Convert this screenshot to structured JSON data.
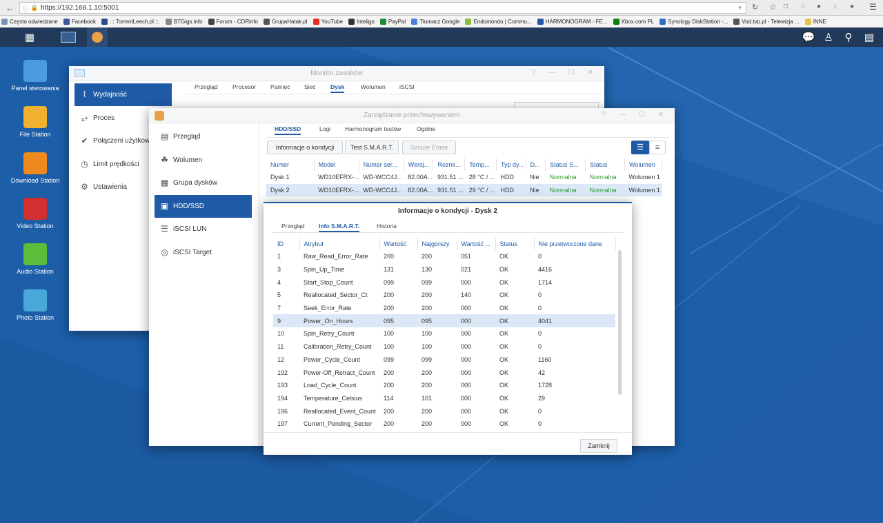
{
  "browser": {
    "url": "https://192.168.1.10:5001",
    "url_highlight": "192.168.1.10",
    "bookmarks": [
      {
        "label": "Często odwiedzane",
        "color": "#7a94b8"
      },
      {
        "label": "Facebook",
        "color": "#3b5998"
      },
      {
        "label": ".:: TorrentLeech.pl ::.",
        "color": "#2c4c8a"
      },
      {
        "label": "BTGigs.info",
        "color": "#888888"
      },
      {
        "label": "Forum - CDRinfo",
        "color": "#444444"
      },
      {
        "label": "GrupaHatak.pl",
        "color": "#555555"
      },
      {
        "label": "YouTube",
        "color": "#e52d27"
      },
      {
        "label": "Inteligo",
        "color": "#333333"
      },
      {
        "label": "PayPal",
        "color": "#1b8e3a"
      },
      {
        "label": "Tłumacz Google",
        "color": "#4a7fdc"
      },
      {
        "label": "Endomondo | Commu...",
        "color": "#8bbd3c"
      },
      {
        "label": "HARMONOGRAM - FE...",
        "color": "#2855a8"
      },
      {
        "label": "Xbox.com PL",
        "color": "#107c10"
      },
      {
        "label": "Synology DiskStation -...",
        "color": "#2e6dc4"
      },
      {
        "label": "Vod.tvp.pl - Telewizja ...",
        "color": "#555555"
      },
      {
        "label": "INNE",
        "color": "#e8c44a"
      }
    ]
  },
  "desktop": {
    "icons": [
      {
        "label": "Panel sterowania",
        "color": "#4b9be0"
      },
      {
        "label": "File Station",
        "color": "#f0b030"
      },
      {
        "label": "Download Station",
        "color": "#f08a20"
      },
      {
        "label": "Video Station",
        "color": "#d03030"
      },
      {
        "label": "Audio Station",
        "color": "#5cbd3a"
      },
      {
        "label": "Photo Station",
        "color": "#4aa8d8"
      }
    ]
  },
  "monitor": {
    "title": "Monitor zasobów",
    "side": [
      "Wydajność",
      "Proces",
      "Połączeni użytkow",
      "Limit prędkości",
      "Ustawienia"
    ],
    "tabs": [
      "Przegląd",
      "Procesor",
      "Pamięć",
      "Sieć",
      "Dysk",
      "Wolumen",
      "iSCSI"
    ],
    "active_tab": "Dysk"
  },
  "storage": {
    "title": "Zarządzanie przechowywaniem",
    "side": [
      "Przegląd",
      "Wolumen",
      "Grupa dysków",
      "HDD/SSD",
      "iSCSI LUN",
      "iSCSI Target"
    ],
    "tabs": [
      "HDD/SSD",
      "Logi",
      "Harmonogram testów",
      "Ogólne"
    ],
    "buttons": [
      "Informacje o kondycji",
      "Test S.M.A.R.T.",
      "Secure Erase"
    ],
    "columns": [
      "Numer",
      "Model",
      "Numer ser...",
      "Wersj...",
      "Rozmi...",
      "Temp...",
      "Typ dy...",
      "D...",
      "Status S...",
      "Status",
      "Wolumen"
    ],
    "rows": [
      [
        "Dysk 1",
        "WD10EFRX-...",
        "WD-WCC4J...",
        "82.00A...",
        "931.51 ...",
        "28 °C / ...",
        "HDD",
        "Nie",
        "Normalna",
        "Normalna",
        "Wolumen 1"
      ],
      [
        "Dysk 2",
        "WD10EFRX-...",
        "WD-WCC4J...",
        "82.00A...",
        "931.51 ...",
        "29 °C / ...",
        "HDD",
        "Nie",
        "Normalna",
        "Normalna",
        "Wolumen 1"
      ]
    ]
  },
  "health": {
    "title": "Informacje o kondycji - Dysk 2",
    "tabs": [
      "Przegląd",
      "Info S.M.A.R.T.",
      "Historia"
    ],
    "columns": [
      "ID",
      "Atrybut",
      "Wartość",
      "Najgorszy",
      "Wartość ...",
      "Status",
      "Nie przetworzone dane"
    ],
    "rows": [
      [
        "1",
        "Raw_Read_Error_Rate",
        "200",
        "200",
        "051",
        "OK",
        "0"
      ],
      [
        "3",
        "Spin_Up_Time",
        "131",
        "130",
        "021",
        "OK",
        "4416"
      ],
      [
        "4",
        "Start_Stop_Count",
        "099",
        "099",
        "000",
        "OK",
        "1714"
      ],
      [
        "5",
        "Reallocated_Sector_Ct",
        "200",
        "200",
        "140",
        "OK",
        "0"
      ],
      [
        "7",
        "Seek_Error_Rate",
        "200",
        "200",
        "000",
        "OK",
        "0"
      ],
      [
        "9",
        "Power_On_Hours",
        "095",
        "095",
        "000",
        "OK",
        "4041"
      ],
      [
        "10",
        "Spin_Retry_Count",
        "100",
        "100",
        "000",
        "OK",
        "0"
      ],
      [
        "11",
        "Calibration_Retry_Count",
        "100",
        "100",
        "000",
        "OK",
        "0"
      ],
      [
        "12",
        "Power_Cycle_Count",
        "099",
        "099",
        "000",
        "OK",
        "1160"
      ],
      [
        "192",
        "Power-Off_Retract_Count",
        "200",
        "200",
        "000",
        "OK",
        "42"
      ],
      [
        "193",
        "Load_Cycle_Count",
        "200",
        "200",
        "000",
        "OK",
        "1728"
      ],
      [
        "194",
        "Temperature_Celsius",
        "114",
        "101",
        "000",
        "OK",
        "29"
      ],
      [
        "196",
        "Reallocated_Event_Count",
        "200",
        "200",
        "000",
        "OK",
        "0"
      ],
      [
        "197",
        "Current_Pending_Sector",
        "200",
        "200",
        "000",
        "OK",
        "0"
      ]
    ],
    "close_label": "Zamknij"
  },
  "colors": {
    "accent": "#1f5aa6",
    "ok": "#2c9e2c",
    "desktop": "#1d5ea8"
  }
}
